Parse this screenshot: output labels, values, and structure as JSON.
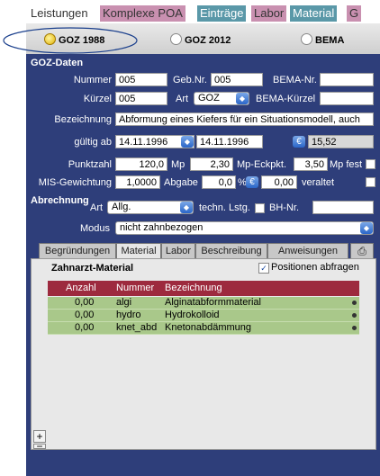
{
  "top_tabs": [
    "Leistungen",
    "Komplexe POA",
    "Einträge",
    "Labor",
    "Material",
    "G"
  ],
  "radio_options": [
    {
      "label": "GOZ 1988",
      "selected": true
    },
    {
      "label": "GOZ 2012",
      "selected": false
    },
    {
      "label": "BEMA",
      "selected": false
    }
  ],
  "goz_daten": {
    "section_title": "GOZ-Daten",
    "nummer_label": "Nummer",
    "nummer": "005",
    "gebnr_label": "Geb.Nr.",
    "gebnr": "005",
    "bema_nr_label": "BEMA-Nr.",
    "bema_nr": "",
    "kuerzel_label": "Kürzel",
    "kuerzel": "005",
    "art_label": "Art",
    "art": "GOZ",
    "bema_kuerzel_label": "BEMA-Kürzel",
    "bema_kuerzel": "",
    "bezeichnung_label": "Bezeichnung",
    "bezeichnung": "Abformung eines Kiefers für ein Situationsmodell, auch",
    "gueltig_ab_label": "gültig ab",
    "gueltig_ab": "14.11.1996",
    "gueltig_bis": "14.11.1996",
    "euro_symbol": "€",
    "euro_value": "15,52",
    "punktzahl_label": "Punktzahl",
    "punktzahl": "120,0",
    "mp_label": "Mp",
    "mp": "2,30",
    "mp_eckpkt_label": "Mp-Eckpkt.",
    "mp_eckpkt": "3,50",
    "mp_fest_label": "Mp fest",
    "mis_label": "MIS-Gewichtung",
    "mis": "1,0000",
    "abgabe_label": "Abgabe",
    "abgabe": "0,0",
    "percent_symbol": "%",
    "abgabe_value": "0,00",
    "veraltet_label": "veraltet"
  },
  "abrechnung": {
    "section_title": "Abrechnung",
    "art_label": "Art",
    "art": "Allg.",
    "techn_label": "techn. Lstg.",
    "bh_nr_label": "BH-Nr.",
    "bh_nr": "",
    "modus_label": "Modus",
    "modus": "nicht zahnbezogen"
  },
  "sub_tabs": [
    "Begründungen",
    "Material",
    "Labor",
    "Beschreibung",
    "Anweisungen"
  ],
  "material": {
    "title": "Zahnarzt-Material",
    "positions_checkbox_label": "Positionen abfragen",
    "columns": [
      "Anzahl",
      "Nummer",
      "Bezeichnung"
    ],
    "rows": [
      {
        "anzahl": "0,00",
        "nummer": "algi",
        "bezeichnung": "Alginatabformmaterial"
      },
      {
        "anzahl": "0,00",
        "nummer": "hydro",
        "bezeichnung": "Hydrokolloid"
      },
      {
        "anzahl": "0,00",
        "nummer": "knet_abd",
        "bezeichnung": "Knetonabdämmung"
      }
    ],
    "add_symbol": "+",
    "remove_symbol": "−"
  },
  "colors": {
    "panel": "#2e3e7a",
    "header_row": "#9d2a3e",
    "data_row": "#a9c88a",
    "tab_pink": "#c990b0",
    "tab_teal": "#5a98a8"
  }
}
